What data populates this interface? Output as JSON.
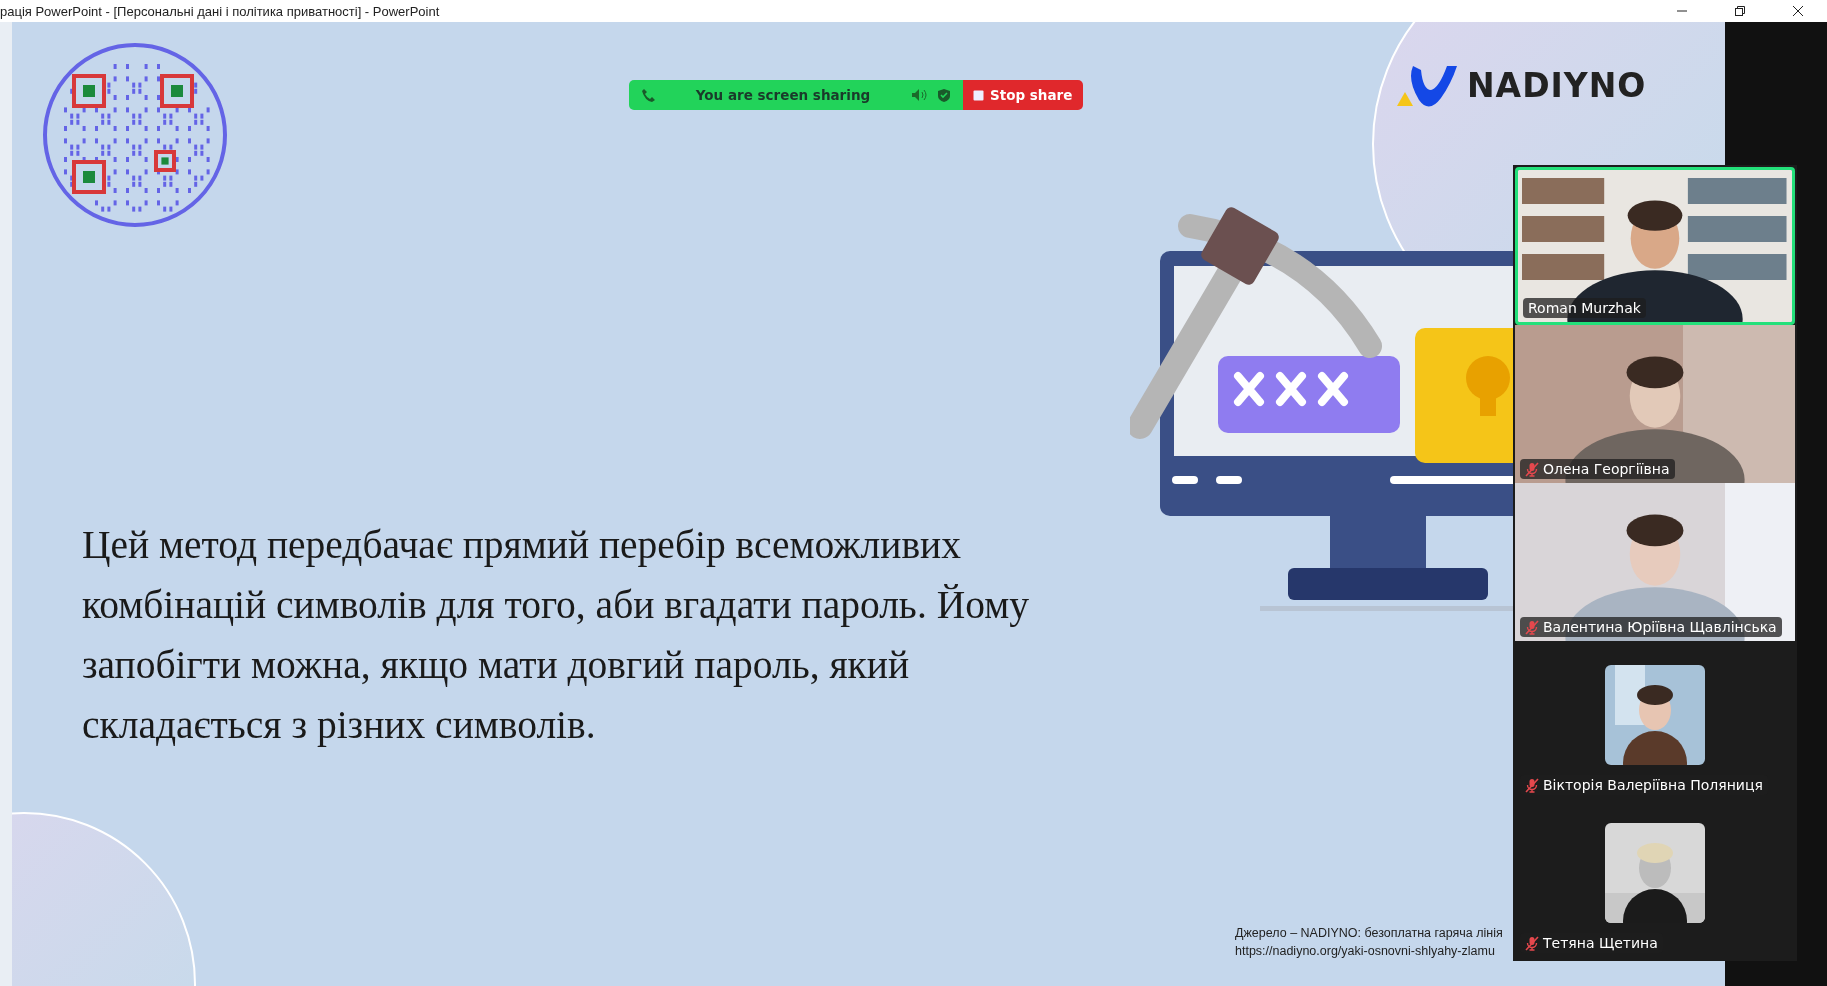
{
  "window": {
    "title": "рація PowerPoint - [Персональні дані і політика приватності] - PowerPoint"
  },
  "share_bar": {
    "message": "You are screen sharing",
    "stop_label": "Stop share"
  },
  "slide": {
    "logo": "NADIYNO",
    "body": "Цей метод передбачає прямий перебір всеможливих комбінацій символів для того, аби вгадати пароль. Йому запобігти можна, якщо мати довгий пароль, який складається з різних символів.",
    "source": [
      "Джерело – NADIYNO: безоплатна гаряча лінія",
      "https://nadiyno.org/yaki-osnovni-shlyahy-zlamu"
    ]
  },
  "participants": [
    {
      "name": "Roman Murzhak",
      "muted": false,
      "active": true,
      "camera_on": true
    },
    {
      "name": "Олена Георгіївна",
      "muted": true,
      "active": false,
      "camera_on": true
    },
    {
      "name": "Валентина Юріївна Щавлінська",
      "muted": true,
      "active": false,
      "camera_on": true
    },
    {
      "name": "Вікторія Валеріївна Поляниця",
      "muted": true,
      "active": false,
      "camera_on": false
    },
    {
      "name": "Тетяна Щетина",
      "muted": true,
      "active": false,
      "camera_on": false
    }
  ]
}
